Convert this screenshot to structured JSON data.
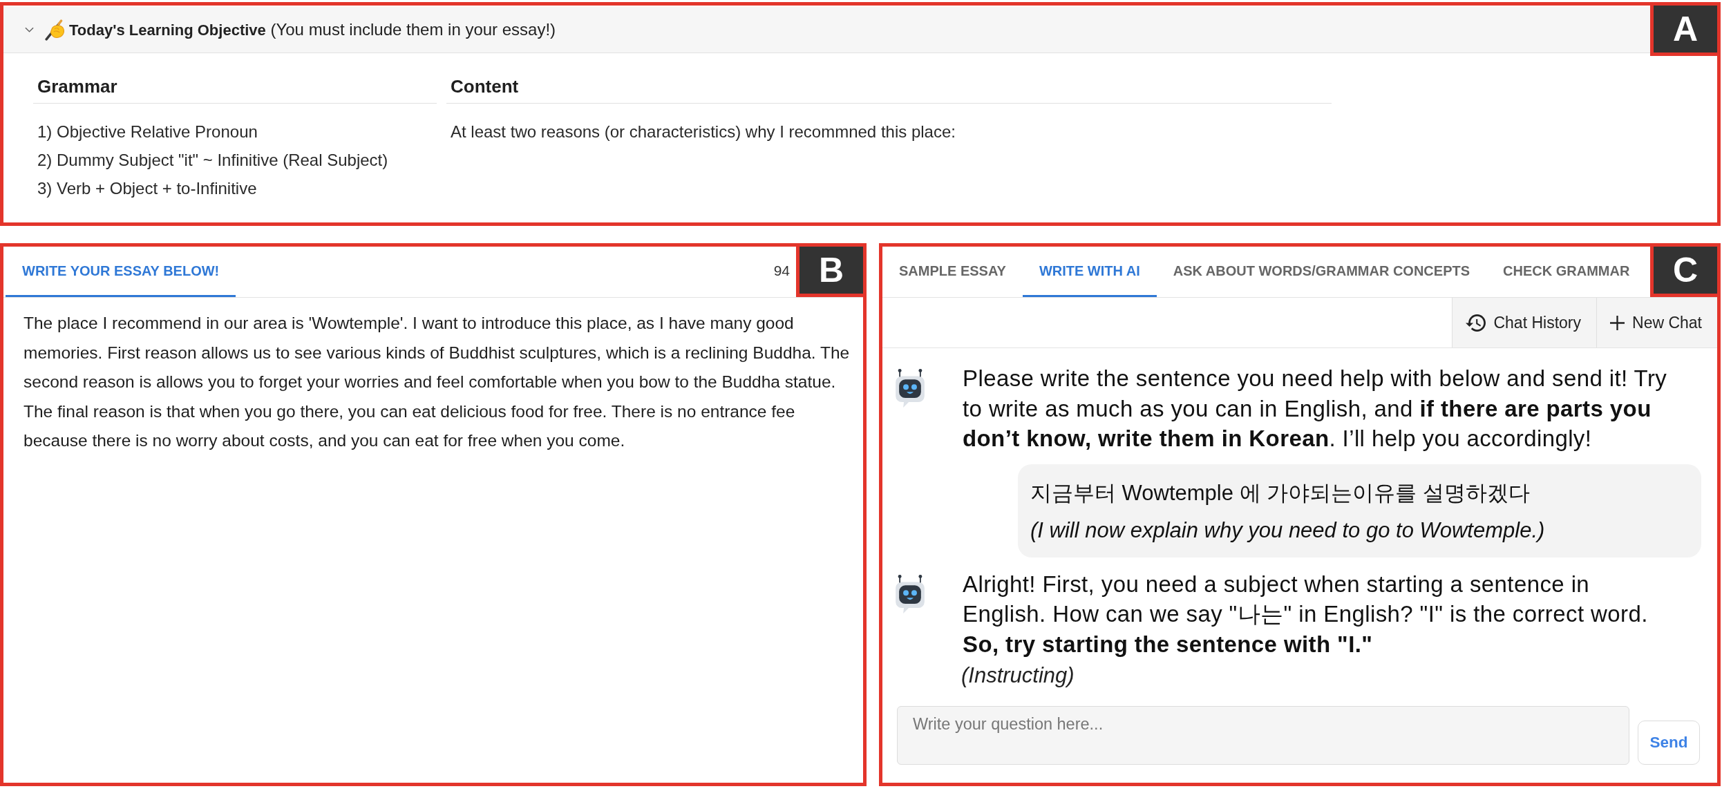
{
  "objective_panel": {
    "region_label": "A",
    "expanded": true,
    "title": "**Today's Learning Objective** (You must include them in your essay!)",
    "columns": [
      {
        "heading": "Grammar",
        "items": [
          "1) Objective Relative Pronoun",
          "2) Dummy Subject \"it\" ~ Infinitive (Real Subject)",
          "3) Verb + Object + to-Infinitive"
        ]
      },
      {
        "heading": "Content",
        "items": [
          "At least two reasons (or characteristics) why I recommned this place:"
        ]
      }
    ]
  },
  "essay_panel": {
    "region_label": "B",
    "tabs": [
      {
        "label": "WRITE YOUR ESSAY BELOW!",
        "selected": true
      }
    ],
    "count": "94",
    "essay": "The place I recommend in our area is 'Wowtemple'. I want to introduce this place, as I have many good memories. First reason allows us to see various kinds of Buddhist sculptures, which is a reclining Buddha. The second reason is allows you to forget your worries and feel comfortable when you bow to the Buddha statue. The final reason is that when you go there, you can eat delicious food for free. There is no entrance fee because there is no worry about costs, and you can eat for free when you come."
  },
  "ai_panel": {
    "region_label": "C",
    "tabs": [
      {
        "label": "SAMPLE ESSAY",
        "selected": false
      },
      {
        "label": "WRITE WITH AI",
        "selected": true
      },
      {
        "label": "ASK ABOUT WORDS/GRAMMAR CONCEPTS",
        "selected": false
      },
      {
        "label": "CHECK GRAMMAR",
        "selected": false
      }
    ],
    "toolbar": [
      {
        "kind": "history",
        "label": "Chat History"
      },
      {
        "kind": "new",
        "label": "New Chat"
      }
    ],
    "messages": [
      {
        "kind": "bot",
        "text": "Please write the sentence you need help with below and send it! Try to write as much as you can in English, and **if there are parts you don’t know, write them in Korean**. I’ll help you accordingly!"
      },
      {
        "kind": "user",
        "text": "지금부터 Wowtemple 에 가야되는이유를 설명하겠다",
        "translation": "(I will now explain why you need to go to Wowtemple.)"
      },
      {
        "kind": "bot",
        "text": "Alright! First, you need a subject when starting a sentence in English. How can we say \"나는\" in English? \"I\" is the correct word. **So, try starting the sentence with \"I.\"**",
        "note": "(Instructing)"
      }
    ],
    "input": {
      "placeholder": "Write your question here..."
    },
    "send_button": "Send"
  }
}
